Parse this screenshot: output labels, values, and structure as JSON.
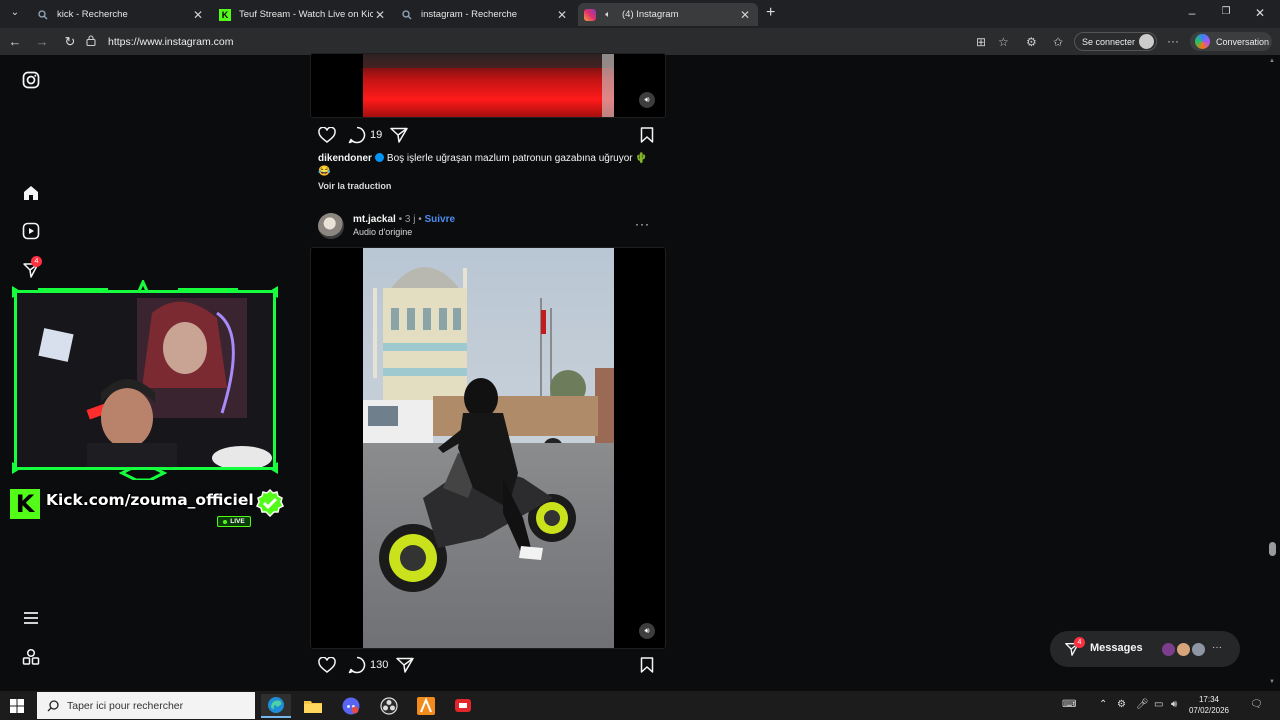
{
  "browser": {
    "tabs": [
      {
        "label": "kick - Recherche",
        "icon": "search-icon",
        "active": false
      },
      {
        "label": "Teuf Stream - Watch Live on Kick",
        "icon": "kick-favicon",
        "active": false
      },
      {
        "label": "instagram - Recherche",
        "icon": "search-icon",
        "active": false
      },
      {
        "label": "(4) Instagram",
        "icon": "instagram-favicon",
        "active": true
      }
    ],
    "url": "https://www.instagram.com",
    "sign_in_label": "Se connecter",
    "copilot_label": "Conversation"
  },
  "sidebar": {
    "items": [
      {
        "name": "instagram-logo-icon"
      },
      {
        "name": "home-icon"
      },
      {
        "name": "reels-icon"
      },
      {
        "name": "direct-messages-icon",
        "badge": "4"
      },
      {
        "name": "more-menu-icon"
      },
      {
        "name": "meta-apps-icon"
      }
    ]
  },
  "feed": {
    "post1": {
      "comments_count": "19",
      "caption_user": "dikendoner",
      "caption_text": "Boş işlerle uğraşan mazlum patronun gazabına uğruyor 🌵😂",
      "translate_label": "Voir la traduction"
    },
    "post2": {
      "username": "mt.jackal",
      "time": "3 j",
      "follow_label": "Suivre",
      "audio_label": "Audio d'origine",
      "comments_count": "130"
    }
  },
  "overlay": {
    "kick_text": "Kick.com/zouma_officiel",
    "live_label": "LIVE"
  },
  "messages": {
    "label": "Messages",
    "badge": "4"
  },
  "taskbar": {
    "search_placeholder": "Taper ici pour rechercher",
    "time": "17:34",
    "date": "07/02/2026"
  },
  "colors": {
    "kick_green": "#53fc18",
    "instagram_blue": "#4d8bf0",
    "notification_red": "#ff3040"
  }
}
